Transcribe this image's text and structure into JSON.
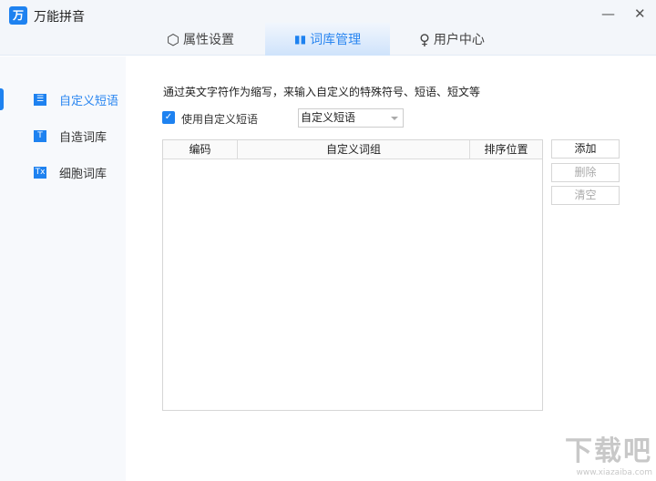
{
  "app": {
    "title": "万能拼音",
    "logo_glyph": "万",
    "minimize": "—",
    "close": "✕"
  },
  "tabs": [
    {
      "label": "属性设置",
      "icon": "hexagon-settings-icon",
      "glyph": "⬡"
    },
    {
      "label": "词库管理",
      "icon": "bar-chart-icon",
      "glyph": "▮▮",
      "active": true
    },
    {
      "label": "用户中心",
      "icon": "user-icon",
      "glyph": "♀"
    }
  ],
  "sidebar": {
    "items": [
      {
        "label": "自定义短语",
        "icon": "phrase-list-icon",
        "glyph": "☰",
        "active": true
      },
      {
        "label": "自造词库",
        "icon": "text-t-icon",
        "glyph": "T"
      },
      {
        "label": "细胞词库",
        "icon": "text-tx-icon",
        "glyph": "Tx"
      }
    ]
  },
  "main": {
    "description": "通过英文字符作为缩写，来输入自定义的特殊符号、短语、短文等",
    "use_checkbox": {
      "label": "使用自定义短语",
      "checked": true,
      "glyph": "✓"
    },
    "dropdown": {
      "value": "自定义短语"
    },
    "table": {
      "columns": [
        "编码",
        "自定义词组",
        "排序位置"
      ],
      "rows": []
    },
    "buttons": {
      "add": "添加",
      "delete": "删除",
      "clear": "清空"
    }
  },
  "watermark": {
    "text": "下载吧",
    "url": "www.xiazaiba.com"
  },
  "colors": {
    "accent": "#1e82f0",
    "disabled_text": "#aaaaaa"
  }
}
